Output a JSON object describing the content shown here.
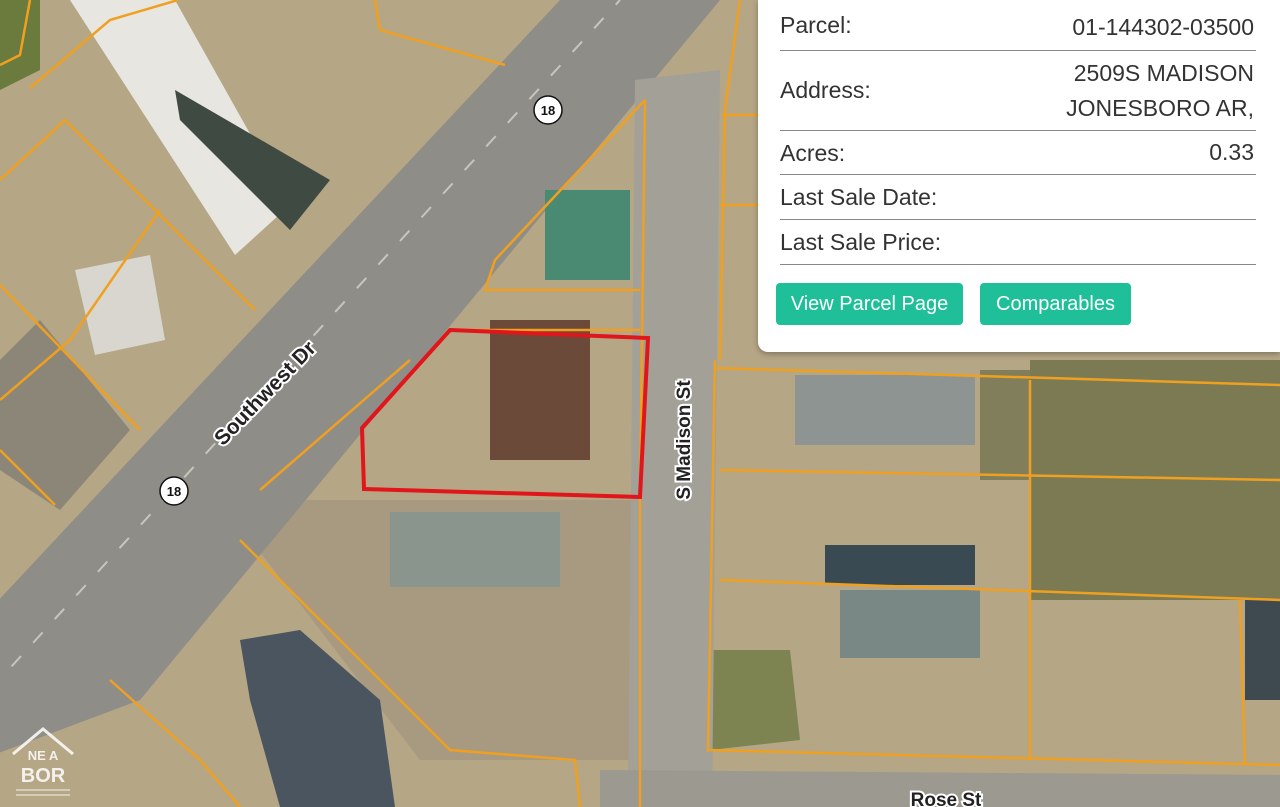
{
  "map": {
    "roads": {
      "southwest": "Southwest Dr",
      "madison": "S Madison St",
      "rose": "Rose St",
      "highway_shield": "18"
    },
    "colors": {
      "parcel_line": "#f0a020",
      "selected_parcel": "#e0161b",
      "road": "#9a9890"
    }
  },
  "info": {
    "parcel_label": "Parcel:",
    "parcel_value": "01-144302-03500",
    "address_label": "Address:",
    "address_line1": "2509S MADISON",
    "address_line2": "JONESBORO AR,",
    "acres_label": "Acres:",
    "acres_value": "0.33",
    "sale_date_label": "Last Sale Date:",
    "sale_date_value": "",
    "sale_price_label": "Last Sale Price:",
    "sale_price_value": ""
  },
  "buttons": {
    "view_parcel": "View Parcel Page",
    "comparables": "Comparables",
    "color": "#1fbf9a"
  },
  "logo": {
    "line1": "NE A",
    "line2": "BOR"
  }
}
